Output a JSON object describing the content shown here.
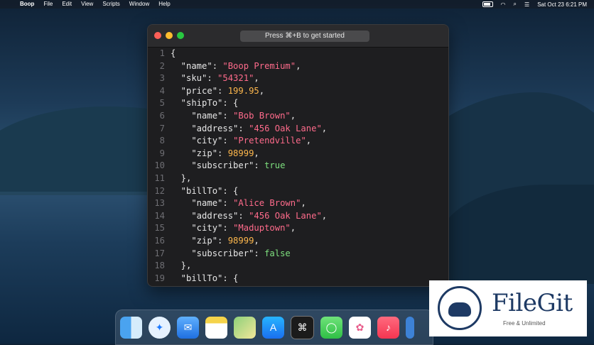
{
  "menubar": {
    "app": "Boop",
    "items": [
      "File",
      "Edit",
      "View",
      "Scripts",
      "Window",
      "Help"
    ],
    "clock": "Sat Oct 23  6:21 PM"
  },
  "window": {
    "hint": "Press ⌘+B to get started"
  },
  "editor": {
    "lines": [
      [
        "1",
        [
          [
            "k",
            "{"
          ]
        ]
      ],
      [
        "2",
        [
          [
            "k",
            "  \"name\": "
          ],
          [
            "s",
            "\"Boop Premium\""
          ],
          [
            "k",
            ","
          ]
        ]
      ],
      [
        "3",
        [
          [
            "k",
            "  \"sku\": "
          ],
          [
            "s",
            "\"54321\""
          ],
          [
            "k",
            ","
          ]
        ]
      ],
      [
        "4",
        [
          [
            "k",
            "  \"price\": "
          ],
          [
            "n",
            "199.95"
          ],
          [
            "k",
            ","
          ]
        ]
      ],
      [
        "5",
        [
          [
            "k",
            "  \"shipTo\": {"
          ]
        ]
      ],
      [
        "6",
        [
          [
            "k",
            "    \"name\": "
          ],
          [
            "s",
            "\"Bob Brown\""
          ],
          [
            "k",
            ","
          ]
        ]
      ],
      [
        "7",
        [
          [
            "k",
            "    \"address\": "
          ],
          [
            "s",
            "\"456 Oak Lane\""
          ],
          [
            "k",
            ","
          ]
        ]
      ],
      [
        "8",
        [
          [
            "k",
            "    \"city\": "
          ],
          [
            "s",
            "\"Pretendville\""
          ],
          [
            "k",
            ","
          ]
        ]
      ],
      [
        "9",
        [
          [
            "k",
            "    \"zip\": "
          ],
          [
            "n",
            "98999"
          ],
          [
            "k",
            ","
          ]
        ]
      ],
      [
        "10",
        [
          [
            "k",
            "    \"subscriber\": "
          ],
          [
            "b",
            "true"
          ]
        ]
      ],
      [
        "11",
        [
          [
            "k",
            "  },"
          ]
        ]
      ],
      [
        "12",
        [
          [
            "k",
            "  \"billTo\": {"
          ]
        ]
      ],
      [
        "13",
        [
          [
            "k",
            "    \"name\": "
          ],
          [
            "s",
            "\"Alice Brown\""
          ],
          [
            "k",
            ","
          ]
        ]
      ],
      [
        "14",
        [
          [
            "k",
            "    \"address\": "
          ],
          [
            "s",
            "\"456 Oak Lane\""
          ],
          [
            "k",
            ","
          ]
        ]
      ],
      [
        "15",
        [
          [
            "k",
            "    \"city\": "
          ],
          [
            "s",
            "\"Maduptown\""
          ],
          [
            "k",
            ","
          ]
        ]
      ],
      [
        "16",
        [
          [
            "k",
            "    \"zip\": "
          ],
          [
            "n",
            "98999"
          ],
          [
            "k",
            ","
          ]
        ]
      ],
      [
        "17",
        [
          [
            "k",
            "    \"subscriber\": "
          ],
          [
            "b",
            "false"
          ]
        ]
      ],
      [
        "18",
        [
          [
            "k",
            "  },"
          ]
        ]
      ],
      [
        "19",
        [
          [
            "k",
            "  \"billTo\": {"
          ]
        ]
      ]
    ]
  },
  "dock": {
    "apps": [
      "finder-icon",
      "safari-icon",
      "mail-icon",
      "notes-icon",
      "maps-icon",
      "app-store-icon",
      "boop-icon",
      "messages-icon",
      "photos-icon",
      "music-icon"
    ]
  },
  "watermark": {
    "brand": "FileGit",
    "tagline": "Free & Unlimited"
  }
}
